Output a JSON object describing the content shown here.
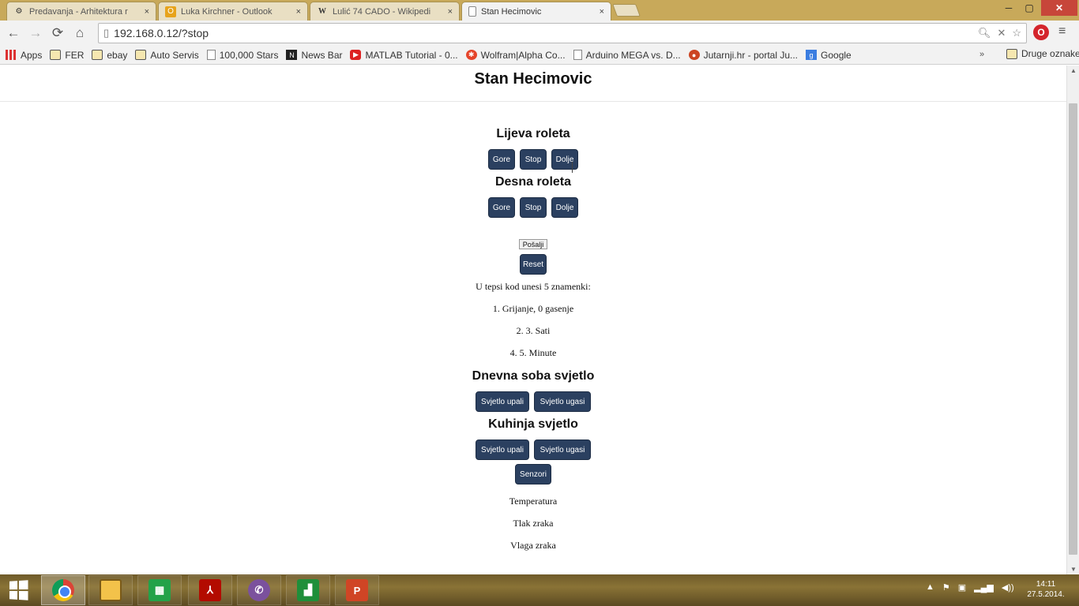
{
  "browser": {
    "tabs": [
      {
        "title": "Predavanja - Arhitektura r",
        "icon": "gears-icon"
      },
      {
        "title": "Luka Kirchner - Outlook",
        "icon": "outlook-icon"
      },
      {
        "title": "Lulić 74 CADO - Wikipedi",
        "icon": "wikipedia-icon"
      },
      {
        "title": "Stan Hecimovic",
        "icon": "page-icon"
      }
    ],
    "tab_close": "×",
    "window_buttons": {
      "minimize": "─",
      "maximize": "▢",
      "close": "✕"
    },
    "nav": {
      "back": "←",
      "forward": "→",
      "reload": "⟳",
      "home": "⌂"
    },
    "url": "192.168.0.12/?stop",
    "extension_label": "O",
    "menu": "≡",
    "bookmarks": [
      {
        "label": "Apps",
        "icon": "apps-icon"
      },
      {
        "label": "FER",
        "icon": "folder-icon"
      },
      {
        "label": "ebay",
        "icon": "folder-icon"
      },
      {
        "label": "Auto Servis",
        "icon": "folder-icon"
      },
      {
        "label": "100,000 Stars",
        "icon": "page-icon"
      },
      {
        "label": "News Bar",
        "icon": "nb-icon"
      },
      {
        "label": "MATLAB Tutorial - 0...",
        "icon": "youtube-icon"
      },
      {
        "label": "Wolfram|Alpha Co...",
        "icon": "wolfram-icon"
      },
      {
        "label": "Arduino MEGA vs. D...",
        "icon": "page-icon"
      },
      {
        "label": "Jutarnji.hr - portal Ju...",
        "icon": "record-icon"
      },
      {
        "label": "Google",
        "icon": "google-icon"
      }
    ],
    "bookmarks_more": "»",
    "other_bookmarks": "Druge oznake"
  },
  "page": {
    "title": "Stan Hecimovic",
    "lijeva": {
      "title": "Lijeva roleta",
      "gore": "Gore",
      "stop": "Stop",
      "dolje": "Dolje"
    },
    "desna": {
      "title": "Desna roleta",
      "gore": "Gore",
      "stop": "Stop",
      "dolje": "Dolje"
    },
    "code_input_value": "Pošalji",
    "reset_label": "Reset",
    "info_lines": [
      "U tepsi kod unesi 5 znamenki:",
      "1. Grijanje, 0 gasenje",
      "2. 3. Sati",
      "4. 5. Minute"
    ],
    "dnevna": {
      "title": "Dnevna soba svjetlo",
      "on": "Svjetlo upali",
      "off": "Svjetlo ugasi"
    },
    "kuhinja": {
      "title": "Kuhinja svjetlo",
      "on": "Svjetlo upali",
      "off": "Svjetlo ugasi"
    },
    "senzori_label": "Senzori",
    "sensors": [
      "Temperatura",
      "Tlak zraka",
      "Vlaga zraka"
    ]
  },
  "taskbar": {
    "apps": [
      {
        "name": "chrome",
        "icon": "chrome-icon"
      },
      {
        "name": "file-explorer",
        "icon": "folder-icon"
      },
      {
        "name": "store",
        "icon": "store-icon"
      },
      {
        "name": "acrobat",
        "icon": "acrobat-icon"
      },
      {
        "name": "viber",
        "icon": "viber-icon"
      },
      {
        "name": "chart-app",
        "icon": "chart-icon"
      },
      {
        "name": "powerpoint",
        "icon": "powerpoint-icon"
      }
    ],
    "tray_icons": [
      "chevron-up-icon",
      "flag-icon",
      "network-icon",
      "signal-icon",
      "speaker-icon"
    ],
    "time": "14:11",
    "date": "27.5.2014."
  },
  "colors": {
    "button_bg": "#2b4060",
    "tab_strip": "#c8a95a",
    "close_button": "#c7463a"
  }
}
